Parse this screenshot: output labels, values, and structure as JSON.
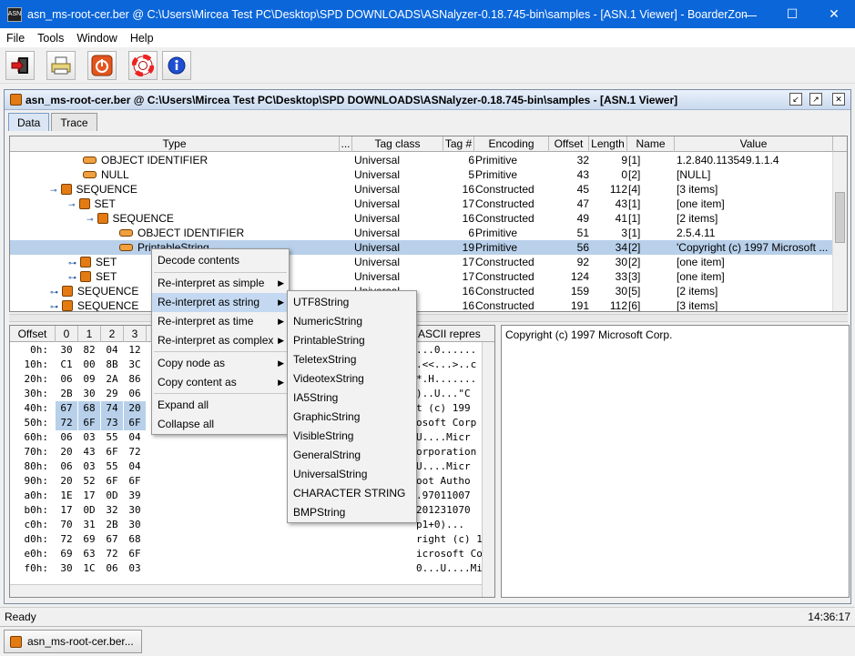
{
  "window": {
    "title": "asn_ms-root-cer.ber @ C:\\Users\\Mircea Test PC\\Desktop\\SPD DOWNLOADS\\ASNalyzer-0.18.745-bin\\samples - [ASN.1 Viewer] - BoarderZone A...",
    "minimize": "—",
    "maximize": "☐",
    "close": "✕"
  },
  "menu": [
    "File",
    "Tools",
    "Window",
    "Help"
  ],
  "toolbar": [
    "open-icon",
    "print-icon",
    "power-icon",
    "lifebuoy-icon",
    "info-icon"
  ],
  "inner": {
    "title": "asn_ms-root-cer.ber @ C:\\Users\\Mircea Test PC\\Desktop\\SPD DOWNLOADS\\ASNalyzer-0.18.745-bin\\samples - [ASN.1 Viewer]",
    "tabs": [
      "Data",
      "Trace"
    ]
  },
  "tree": {
    "columns": [
      "Type",
      "...",
      "Tag class",
      "Tag #",
      "Encoding",
      "Offset",
      "Length",
      "Name",
      "Value"
    ],
    "rows": [
      {
        "type": "OBJECT IDENTIFIER",
        "tc": "Universal",
        "tn": "6",
        "enc": "Primitive",
        "off": "32",
        "len": "9",
        "name": "[1]",
        "val": "1.2.840.113549.1.1.4"
      },
      {
        "type": "NULL",
        "tc": "Universal",
        "tn": "5",
        "enc": "Primitive",
        "off": "43",
        "len": "0",
        "name": "[2]",
        "val": "[NULL]"
      },
      {
        "type": "SEQUENCE",
        "tc": "Universal",
        "tn": "16",
        "enc": "Constructed",
        "off": "45",
        "len": "112",
        "name": "[4]",
        "val": "[3 items]"
      },
      {
        "type": "SET",
        "tc": "Universal",
        "tn": "17",
        "enc": "Constructed",
        "off": "47",
        "len": "43",
        "name": "[1]",
        "val": "[one item]"
      },
      {
        "type": "SEQUENCE",
        "tc": "Universal",
        "tn": "16",
        "enc": "Constructed",
        "off": "49",
        "len": "41",
        "name": "[1]",
        "val": "[2 items]"
      },
      {
        "type": "OBJECT IDENTIFIER",
        "tc": "Universal",
        "tn": "6",
        "enc": "Primitive",
        "off": "51",
        "len": "3",
        "name": "[1]",
        "val": "2.5.4.11"
      },
      {
        "type": "PrintableString",
        "tc": "Universal",
        "tn": "19",
        "enc": "Primitive",
        "off": "56",
        "len": "34",
        "name": "[2]",
        "val": "'Copyright (c) 1997 Microsoft ..."
      },
      {
        "type": "SET",
        "tc": "Universal",
        "tn": "17",
        "enc": "Constructed",
        "off": "92",
        "len": "30",
        "name": "[2]",
        "val": "[one item]"
      },
      {
        "type": "SET",
        "tc": "Universal",
        "tn": "17",
        "enc": "Constructed",
        "off": "124",
        "len": "33",
        "name": "[3]",
        "val": "[one item]"
      },
      {
        "type": "SEQUENCE",
        "tc": "Universal",
        "tn": "16",
        "enc": "Constructed",
        "off": "159",
        "len": "30",
        "name": "[5]",
        "val": "[2 items]"
      },
      {
        "type": "SEQUENCE",
        "tc": "Universal",
        "tn": "16",
        "enc": "Constructed",
        "off": "191",
        "len": "112",
        "name": "[6]",
        "val": "[3 items]"
      }
    ]
  },
  "hex": {
    "columns": [
      "Offset",
      "0",
      "1",
      "2",
      "3",
      "ASCII repres"
    ],
    "rows": [
      {
        "off": "0h:",
        "b": [
          "30",
          "82",
          "04",
          "12"
        ],
        "ascii": "...0......"
      },
      {
        "off": "10h:",
        "b": [
          "C1",
          "00",
          "8B",
          "3C"
        ],
        "ascii": ".<<...>..c"
      },
      {
        "off": "20h:",
        "b": [
          "06",
          "09",
          "2A",
          "86"
        ],
        "ascii": "*.H......."
      },
      {
        "off": "30h:",
        "b": [
          "2B",
          "30",
          "29",
          "06"
        ],
        "ascii": ")..U...\"C"
      },
      {
        "off": "40h:",
        "b": [
          "67",
          "68",
          "74",
          "20"
        ],
        "ascii": "t (c) 199"
      },
      {
        "off": "50h:",
        "b": [
          "72",
          "6F",
          "73",
          "6F"
        ],
        "ascii": "osoft Corp"
      },
      {
        "off": "60h:",
        "b": [
          "06",
          "03",
          "55",
          "04"
        ],
        "ascii": "U....Micr"
      },
      {
        "off": "70h:",
        "b": [
          "20",
          "43",
          "6F",
          "72"
        ],
        "ascii": "orporation"
      },
      {
        "off": "80h:",
        "b": [
          "06",
          "03",
          "55",
          "04"
        ],
        "ascii": "U....Micr"
      },
      {
        "off": "90h:",
        "b": [
          "20",
          "52",
          "6F",
          "6F"
        ],
        "ascii": "oot Autho"
      },
      {
        "off": "a0h:",
        "b": [
          "1E",
          "17",
          "0D",
          "39"
        ],
        "ascii": ".97011007"
      },
      {
        "off": "b0h:",
        "b": [
          "17",
          "0D",
          "32",
          "30"
        ],
        "ascii": "201231070"
      },
      {
        "off": "c0h:",
        "b": [
          "70",
          "31",
          "2B",
          "30"
        ],
        "ascii": "p1+0)..."
      },
      {
        "off": "d0h:",
        "b": [
          "72",
          "69",
          "67",
          "68"
        ],
        "ascii": "right (c) 1"
      },
      {
        "off": "e0h:",
        "b": [
          "69",
          "63",
          "72",
          "6F"
        ],
        "ascii": "icrosoft Co"
      },
      {
        "off": "f0h:",
        "b": [
          "30",
          "1C",
          "06",
          "03"
        ],
        "ascii": "0...U....Mi"
      }
    ]
  },
  "text_panel": "Copyright (c) 1997 Microsoft Corp.",
  "context_menu": {
    "items": [
      "Decode contents",
      "Re-interpret as simple",
      "Re-interpret as string",
      "Re-interpret as time",
      "Re-interpret as complex",
      "Copy node as",
      "Copy content as",
      "Expand all",
      "Collapse all"
    ]
  },
  "submenu": {
    "items": [
      "UTF8String",
      "NumericString",
      "PrintableString",
      "TeletexString",
      "VideotexString",
      "IA5String",
      "GraphicString",
      "VisibleString",
      "GeneralString",
      "UniversalString",
      "CHARACTER STRING",
      "BMPString"
    ]
  },
  "status": {
    "left": "Ready",
    "time": "14:36:17"
  },
  "taskbar": {
    "item": "asn_ms-root-cer.ber..."
  }
}
